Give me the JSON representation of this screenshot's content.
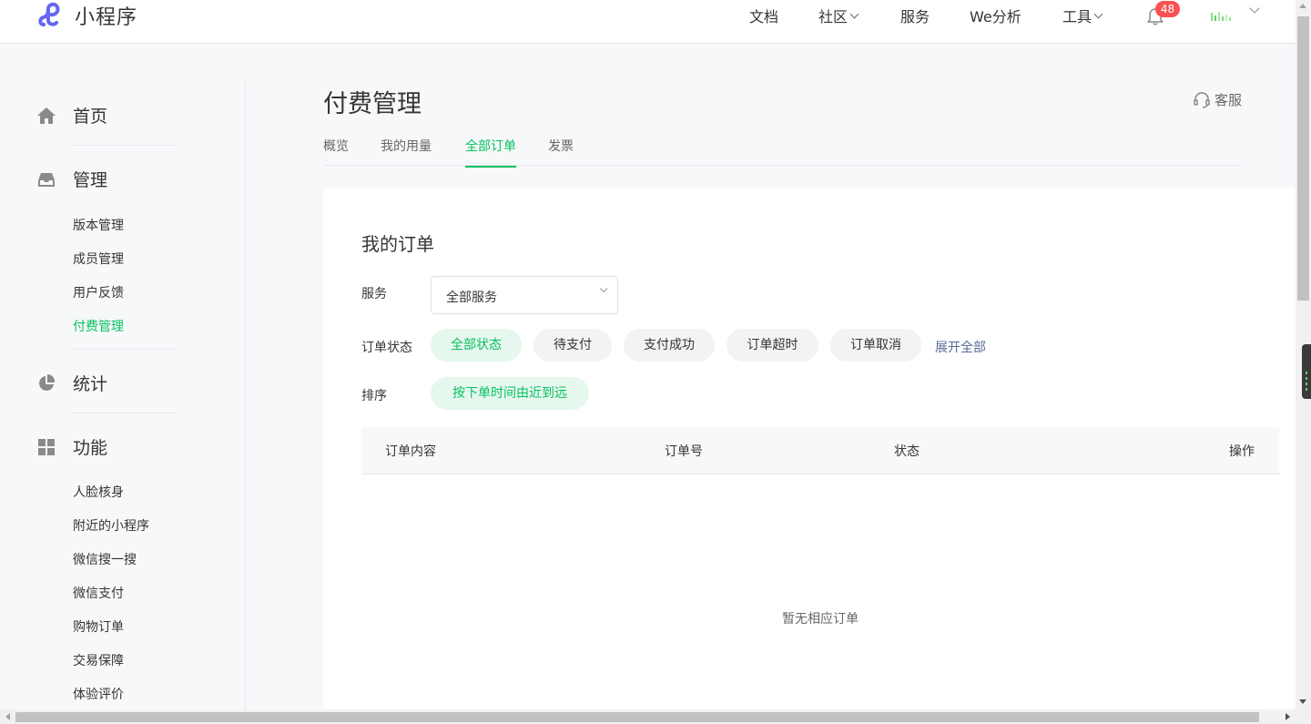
{
  "header": {
    "app_name": "小程序",
    "nav": [
      {
        "label": "文档",
        "has_dropdown": false
      },
      {
        "label": "社区",
        "has_dropdown": true
      },
      {
        "label": "服务",
        "has_dropdown": false
      },
      {
        "label": "We分析",
        "has_dropdown": false
      },
      {
        "label": "工具",
        "has_dropdown": true
      }
    ],
    "notification_count": "48",
    "brand_color": "#07c160",
    "logo_color": "#6467f0"
  },
  "sidebar": {
    "groups": [
      {
        "label": "首页",
        "icon": "home-icon"
      },
      {
        "label": "管理",
        "icon": "inbox-icon",
        "items": [
          "版本管理",
          "成员管理",
          "用户反馈",
          "付费管理"
        ]
      },
      {
        "label": "统计",
        "icon": "pie-chart-icon"
      },
      {
        "label": "功能",
        "icon": "grid-icon",
        "items": [
          "人脸核身",
          "附近的小程序",
          "微信搜一搜",
          "微信支付",
          "购物订单",
          "交易保障",
          "体验评价"
        ]
      }
    ],
    "active_item": "付费管理"
  },
  "main": {
    "title": "付费管理",
    "customer_service": "客服",
    "tabs": [
      "概览",
      "我的用量",
      "全部订单",
      "发票"
    ],
    "active_tab": "全部订单",
    "card": {
      "title": "我的订单",
      "service_label": "服务",
      "service_value": "全部服务",
      "status_label": "订单状态",
      "statuses": [
        "全部状态",
        "待支付",
        "支付成功",
        "订单超时",
        "订单取消"
      ],
      "active_status": "全部状态",
      "expand_label": "展开全部",
      "sort_label": "排序",
      "sort_value": "按下单时间由近到远",
      "table": {
        "columns": [
          "订单内容",
          "订单号",
          "状态",
          "操作"
        ]
      },
      "empty_text": "暂无相应订单"
    }
  }
}
